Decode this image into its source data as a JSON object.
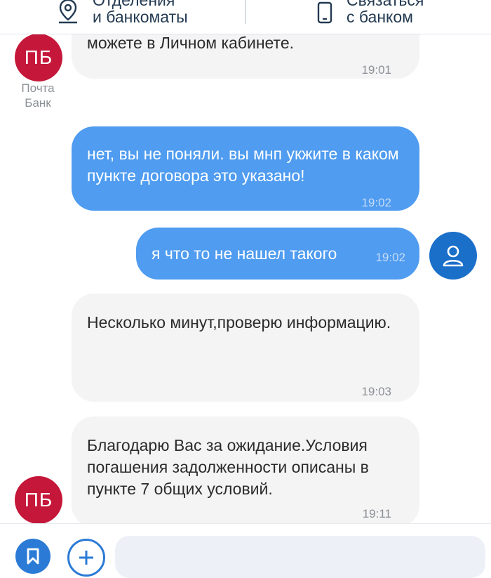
{
  "header": {
    "branches_line1": "Отделения",
    "branches_line2": "и банкоматы",
    "contact_line1": "Связаться",
    "contact_line2": "с банком"
  },
  "messages": [
    {
      "side": "in",
      "text": "можете в Личном кабинете.",
      "time": "19:01"
    },
    {
      "side": "out",
      "text": "нет, вы не поняли. вы мнп укжите в каком пункте  договора это указано!",
      "time": "19:02"
    },
    {
      "side": "out",
      "text": "я что то не нашел такого",
      "time": "19:02"
    },
    {
      "side": "in",
      "text": "Несколько минут,проверю информацию.",
      "time": "19:03"
    },
    {
      "side": "in",
      "text": "Благодарю Вас за ожидание.Условия погашения задолженности описаны в пункте 7  общих условий.",
      "time": "19:11"
    }
  ],
  "bank": {
    "initials": "ПБ",
    "name_line1": "Почта",
    "name_line2": "Банк",
    "color": "#c5173a"
  },
  "colors": {
    "outgoing_bubble": "#4f9cf0",
    "incoming_bubble": "#f4f4f4",
    "accent": "#2b7bd6"
  },
  "icons": {
    "branches": "map-pin-icon",
    "contact": "phone-icon",
    "user": "user-icon",
    "bookmark": "bookmark-icon",
    "add": "plus-icon"
  },
  "composer": {
    "placeholder": ""
  }
}
